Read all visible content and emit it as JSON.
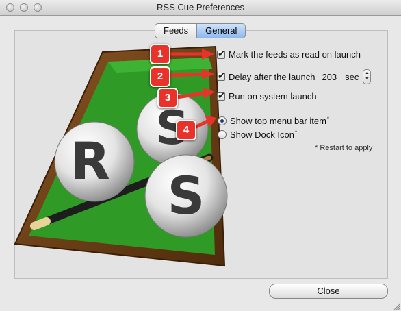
{
  "window": {
    "title": "RSS Cue Preferences"
  },
  "tabs": [
    {
      "label": "Feeds",
      "active": false
    },
    {
      "label": "General",
      "active": true
    }
  ],
  "options": {
    "mark_read": {
      "label": "Mark the feeds as read on launch",
      "checked": true
    },
    "delay": {
      "label": "Delay after the launch",
      "value": "203",
      "unit": "sec",
      "checked": true
    },
    "run_on_launch": {
      "label": "Run on system launch",
      "checked": true
    },
    "show_menu_bar": {
      "label": "Show top menu bar item",
      "marker": "*",
      "selected": true
    },
    "show_dock": {
      "label": "Show Dock Icon",
      "marker": "*",
      "selected": false
    },
    "restart_note": "* Restart to apply"
  },
  "callouts": [
    "1",
    "2",
    "3",
    "4"
  ],
  "buttons": {
    "close": "Close"
  },
  "colors": {
    "callout": "#e9322a",
    "tab_active": "#8db8ee",
    "felt": "#2f9a25",
    "wood": "#6b3d16"
  },
  "logo": {
    "letters": [
      "R",
      "S",
      "S"
    ]
  }
}
